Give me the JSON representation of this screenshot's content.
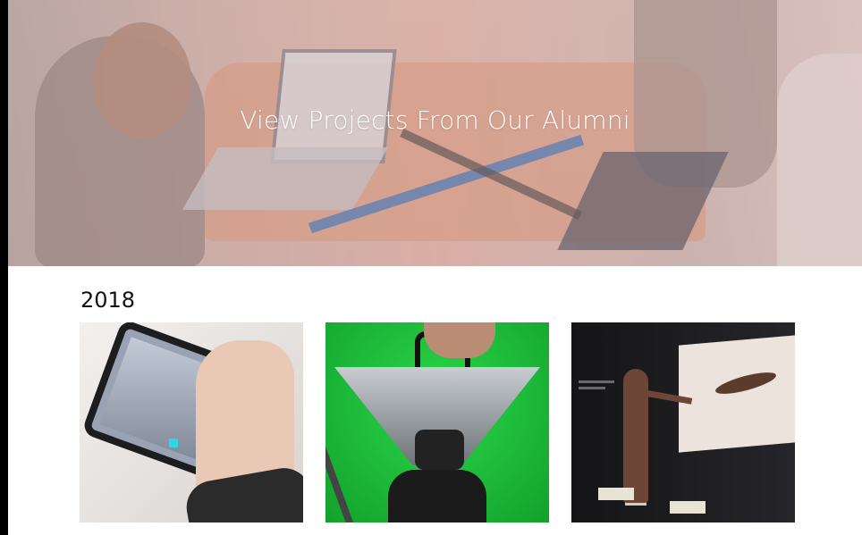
{
  "hero": {
    "title": "View Projects From Our Alumni"
  },
  "sections": [
    {
      "year": "2018",
      "projects": [
        {
          "image": "augmented-reality-phone-book"
        },
        {
          "image": "360-camera-rig"
        },
        {
          "image": "interactive-projection-installation"
        }
      ]
    }
  ]
}
